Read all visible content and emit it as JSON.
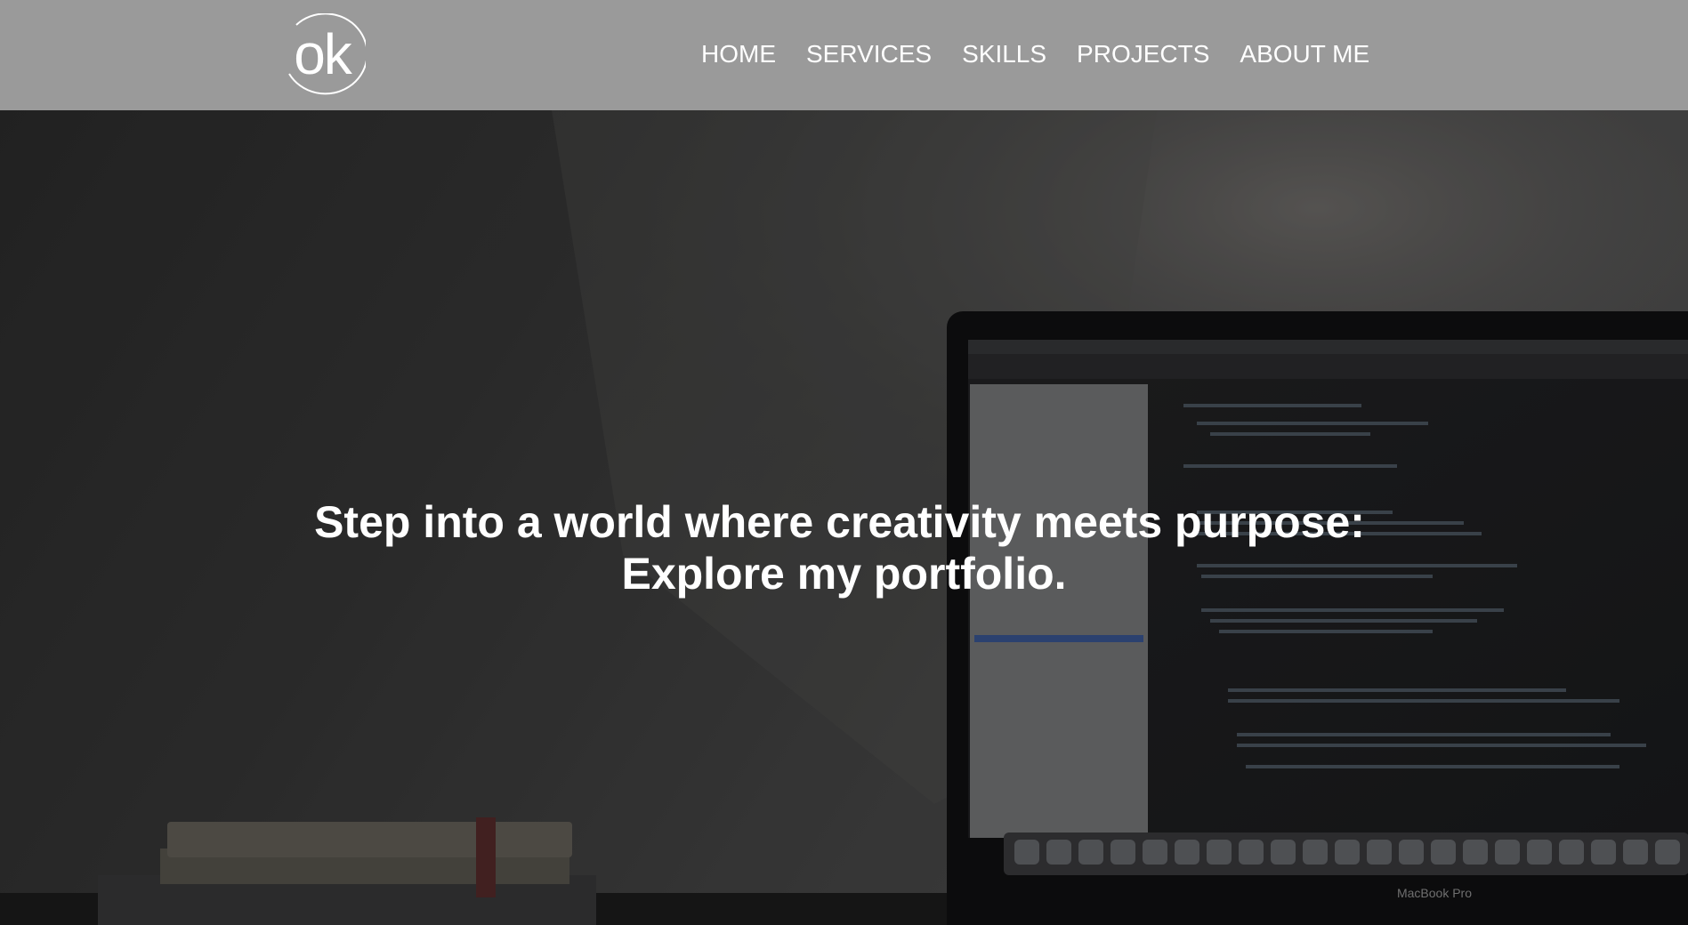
{
  "header": {
    "logo_text": "ok",
    "background_color": "#9a9a9a"
  },
  "nav": {
    "items": [
      {
        "label": "HOME"
      },
      {
        "label": "SERVICES"
      },
      {
        "label": "SKILLS"
      },
      {
        "label": "PROJECTS"
      },
      {
        "label": "ABOUT ME"
      }
    ]
  },
  "hero": {
    "title_line1": "Step into a world where creativity meets purpose:",
    "title_line2": "Explore my portfolio.",
    "background_image": "dim desk scene with laptop showing code editor and stack of books",
    "laptop_label": "MacBook Pro"
  }
}
